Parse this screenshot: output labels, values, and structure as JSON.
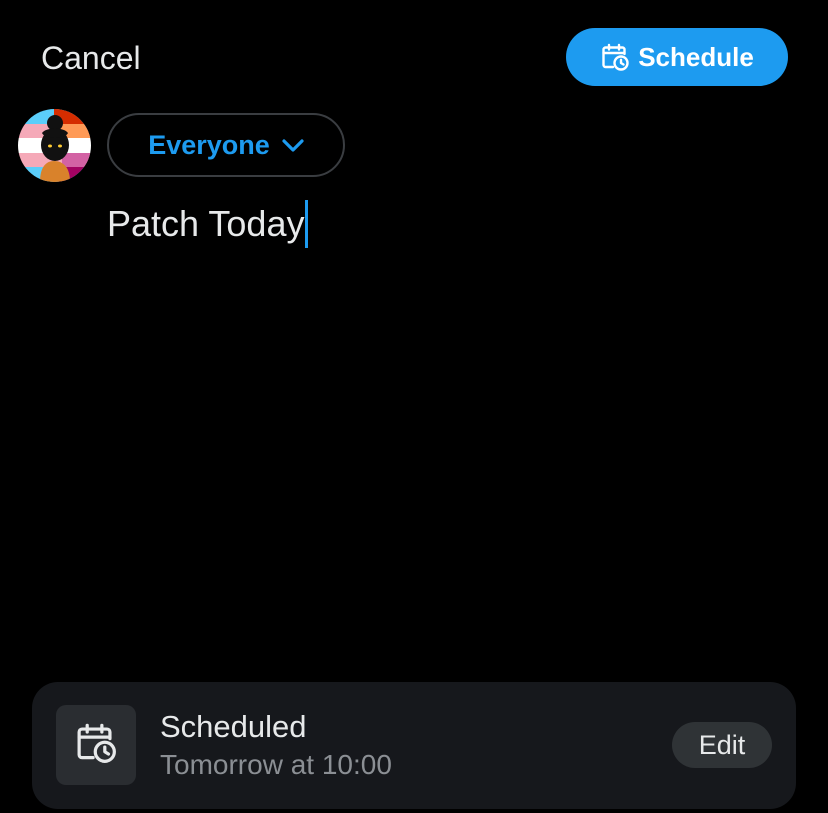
{
  "header": {
    "cancel_label": "Cancel",
    "schedule_label": "Schedule",
    "schedule_icon": "calendar-clock-icon"
  },
  "composer": {
    "avatar_icon": "avatar",
    "audience_label": "Everyone",
    "audience_icon": "chevron-down-icon",
    "text": "Patch Today"
  },
  "scheduled_card": {
    "icon": "calendar-clock-icon",
    "title": "Scheduled",
    "subtitle": "Tomorrow at 10:00",
    "edit_label": "Edit"
  },
  "colors": {
    "accent": "#1d9bf0",
    "background": "#000000",
    "card_background": "#16181c",
    "muted_text": "#8b8f94"
  }
}
